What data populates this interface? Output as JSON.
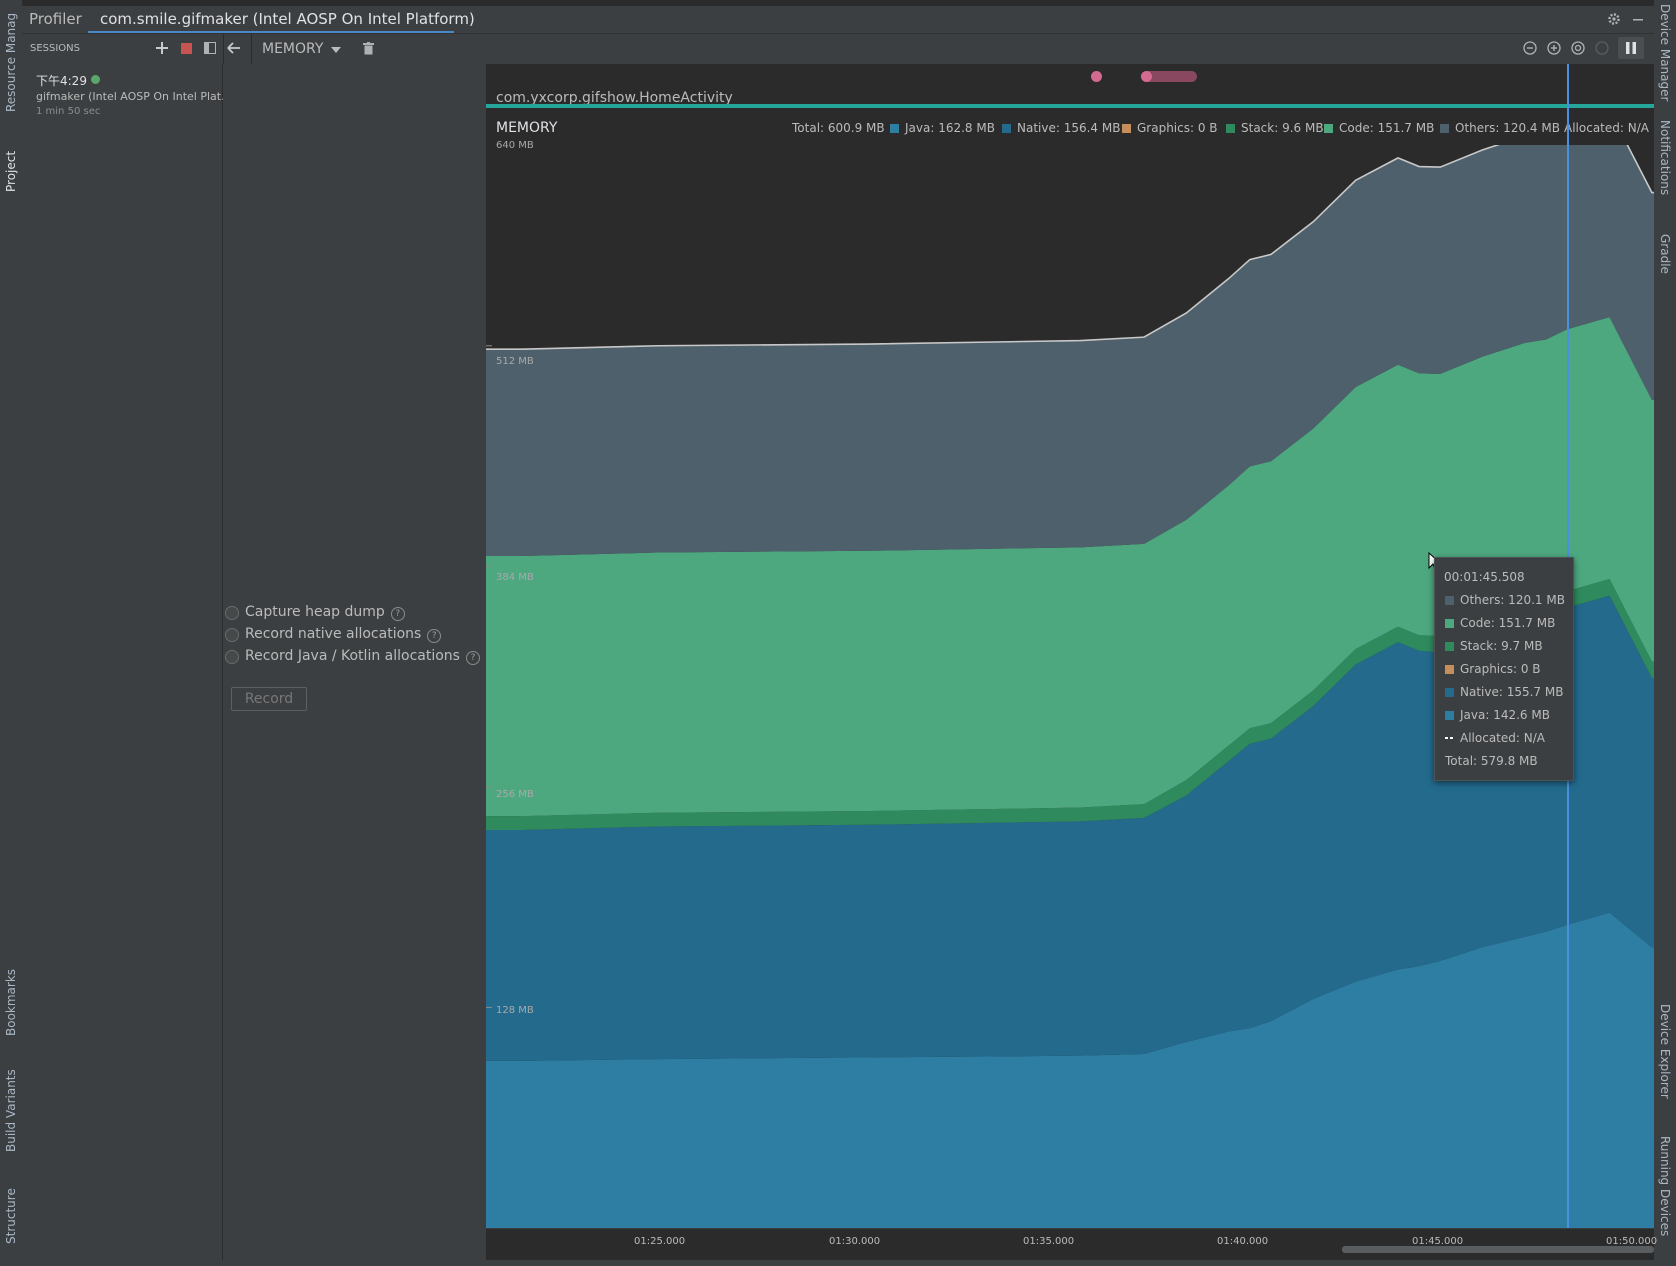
{
  "left_strip": {
    "top_tabs": [
      "Resource Manag",
      "Project"
    ],
    "bottom_tabs": [
      "Bookmarks",
      "Build Variants",
      "Structure"
    ]
  },
  "right_strip": {
    "top_tabs": [
      "Device Manager",
      "Notifications",
      "Gradle"
    ],
    "bottom_tabs": [
      "Device Explorer",
      "Running Devices"
    ]
  },
  "header": {
    "tool_title": "Profiler",
    "active_tab": "com.smile.gifmaker (Intel AOSP On Intel Platform)"
  },
  "toolbar": {
    "sessions_label": "SESSIONS",
    "add_icon": "plus-icon",
    "stop_icon": "stop-icon",
    "layout_icon": "panel-icon",
    "back_icon": "back-arrow-icon",
    "profiler_select": "MEMORY",
    "delete_icon": "trash-icon",
    "zoom_out_icon": "zoom-out-icon",
    "zoom_in_icon": "zoom-in-icon",
    "reset_zoom_icon": "reset-zoom-icon",
    "pause_icon": "pause-icon"
  },
  "session": {
    "time": "下午4:29",
    "status_color": "#59a869",
    "name": "gifmaker (Intel AOSP On Intel Plat...",
    "duration": "1 min 50 sec"
  },
  "options": {
    "items": [
      "Capture heap dump",
      "Record native allocations",
      "Record Java / Kotlin allocations"
    ],
    "help_glyph": "?",
    "record_button": "Record"
  },
  "activity": {
    "label": "com.yxcorp.gifshow.HomeActivity",
    "bar_color": "#26a69a"
  },
  "memory": {
    "title": "MEMORY",
    "legend": [
      {
        "text": "Total: 600.9 MB",
        "color": ""
      },
      {
        "text": "Java: 162.8 MB",
        "color": "#2e7da3"
      },
      {
        "text": "Native: 156.4 MB",
        "color": "#236a8d"
      },
      {
        "text": "Graphics: 0 B",
        "color": "#c58e5a"
      },
      {
        "text": "Stack: 9.6 MB",
        "color": "#2f8a5e"
      },
      {
        "text": "Code: 151.7 MB",
        "color": "#4da880"
      },
      {
        "text": "Others: 120.4 MB",
        "color": "#4e606b"
      },
      {
        "text": "Allocated: N/A",
        "color": ""
      }
    ]
  },
  "tooltip": {
    "time": "00:01:45.508",
    "rows": [
      {
        "text": "Others: 120.1 MB",
        "color": "#4e606b"
      },
      {
        "text": "Code: 151.7 MB",
        "color": "#4da880"
      },
      {
        "text": "Stack: 9.7 MB",
        "color": "#2f8a5e"
      },
      {
        "text": "Graphics: 0 B",
        "color": "#c58e5a"
      },
      {
        "text": "Native: 155.7 MB",
        "color": "#236a8d"
      },
      {
        "text": "Java: 142.6 MB",
        "color": "#2e7da3"
      },
      {
        "text": "Allocated: N/A",
        "color": "dash"
      }
    ],
    "total": "Total: 579.8 MB"
  },
  "chart_data": {
    "type": "area",
    "title": "MEMORY",
    "y_ticks": [
      "640 MB",
      "512 MB",
      "384 MB",
      "256 MB",
      "128 MB"
    ],
    "ylim": [
      0,
      640
    ],
    "x_ticks": [
      "01:25.000",
      "01:30.000",
      "01:35.000",
      "01:40.000",
      "01:45.000",
      "01:50.000"
    ],
    "x": [
      1.3,
      4.5,
      9.5,
      14.5,
      16.0,
      17.0,
      18.0,
      18.5,
      19.0,
      20.0,
      21.0,
      22.0,
      22.5,
      23.0,
      24.0,
      25.0,
      25.5,
      26.0,
      27.0,
      28.0
    ],
    "series": [
      {
        "name": "Java",
        "color": "#2e7da3",
        "values": [
          97,
          98,
          99,
          100,
          101,
          108,
          114,
          116,
          120,
          133,
          143,
          150,
          152,
          155,
          163,
          169,
          172,
          176,
          183,
          162.8
        ]
      },
      {
        "name": "Native",
        "color": "#236a8d",
        "values": [
          134,
          135,
          135,
          136,
          137,
          143,
          157,
          165,
          164,
          170,
          184,
          190,
          183,
          179,
          181,
          183,
          182,
          184,
          184,
          156.4
        ]
      },
      {
        "name": "Graphics",
        "color": "#c58e5a",
        "values": [
          0,
          0,
          0,
          0,
          0,
          0,
          0,
          0,
          0,
          0,
          0,
          0,
          0,
          0,
          0,
          0,
          0,
          0,
          0,
          0
        ]
      },
      {
        "name": "Stack",
        "color": "#2f8a5e",
        "values": [
          8,
          8,
          8,
          8,
          8,
          9,
          9,
          9,
          9,
          9,
          9,
          9,
          9,
          9.7,
          9.7,
          9.7,
          9.6,
          9.6,
          9.6,
          9.6
        ]
      },
      {
        "name": "Code",
        "color": "#4da880",
        "values": [
          151,
          151,
          151,
          151,
          151,
          151,
          151,
          152,
          152,
          152,
          152,
          152,
          152,
          152,
          152,
          152,
          152,
          152,
          152,
          151.7
        ]
      },
      {
        "name": "Others",
        "color": "#4e606b",
        "values": [
          120,
          120,
          120,
          120,
          120,
          120,
          120,
          120,
          120,
          120,
          120,
          120,
          120,
          120,
          120,
          120,
          120,
          120,
          120,
          120.4
        ]
      }
    ],
    "total_line_color": "#c8c8c8",
    "cursor_time": 26.0,
    "cursor_color": "#4a8fe0"
  },
  "timeline_dots": [
    {
      "color": "#d46a8f"
    },
    {
      "color": "#d46a8f"
    }
  ]
}
